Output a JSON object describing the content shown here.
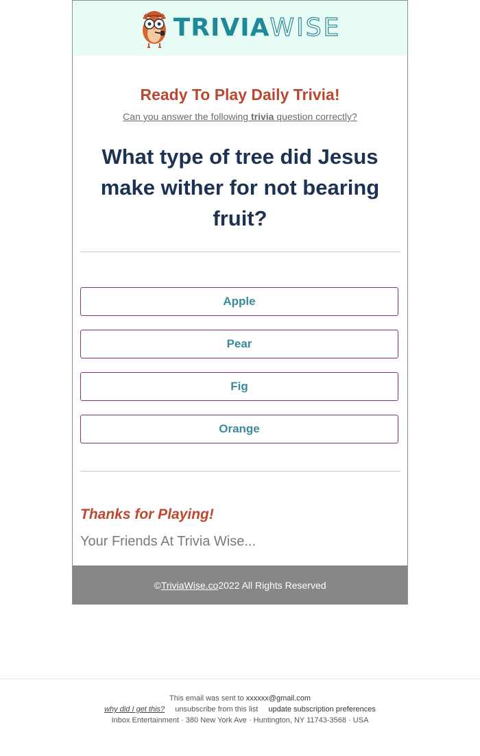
{
  "brand": {
    "part1": "TRIVIA",
    "part2": "WISE"
  },
  "intro": {
    "title": "Ready To Play Daily Trivia!",
    "subtitle_before": "Can you answer the following ",
    "subtitle_bold": "trivia",
    "subtitle_after": " question correctly?"
  },
  "question": "What type of tree did Jesus make wither for not bearing fruit?",
  "answers": [
    {
      "label": "Apple"
    },
    {
      "label": "Pear"
    },
    {
      "label": "Fig"
    },
    {
      "label": "Orange"
    }
  ],
  "closing": {
    "thanks": "Thanks for Playing!",
    "signoff": "Your Friends At Trivia Wise..."
  },
  "copyright": {
    "prefix": "© ",
    "link": "TriviaWise.co",
    "suffix": " 2022 All Rights Reserved"
  },
  "mail_footer": {
    "sent_to_prefix": "This email was sent to ",
    "email": "xxxxxx@gmail.com",
    "why": "why did I get this?",
    "unsubscribe": "unsubscribe from this list",
    "preferences": "update subscription preferences",
    "address": "Inbox Entertainment · 380 New York Ave · Huntington, NY 11743-3568 · USA"
  },
  "colors": {
    "header_bg": "#e5fbf3",
    "brand_teal": "#1f8a97",
    "title_red": "#b8482f",
    "question_navy": "#1d3152",
    "answer_border": "#8a2a8a",
    "answer_text": "#3a8a9a",
    "footer_gray": "#868787"
  }
}
